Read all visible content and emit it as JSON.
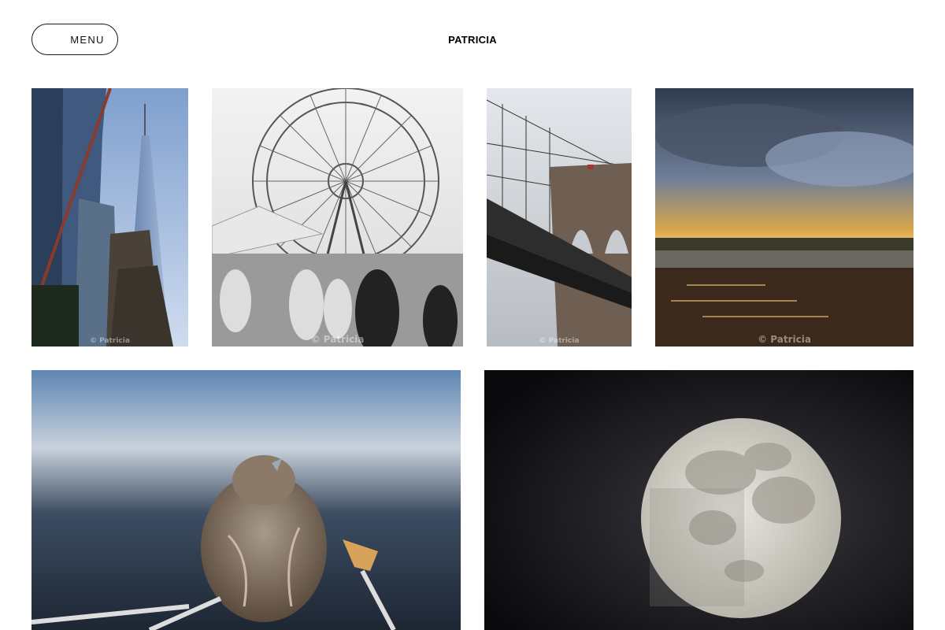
{
  "header": {
    "menu_label": "MENU",
    "site_title": "PATRICIA"
  },
  "gallery": {
    "photos": [
      {
        "subject": "skyscrapers",
        "watermark": "© Patricia"
      },
      {
        "subject": "ferris-wheel",
        "watermark": "© Patricia"
      },
      {
        "subject": "bridge",
        "watermark": "© Patricia"
      },
      {
        "subject": "harbor-sunset",
        "watermark": "© Patricia"
      },
      {
        "subject": "sparrow",
        "watermark": ""
      },
      {
        "subject": "full-moon",
        "watermark": ""
      }
    ]
  }
}
